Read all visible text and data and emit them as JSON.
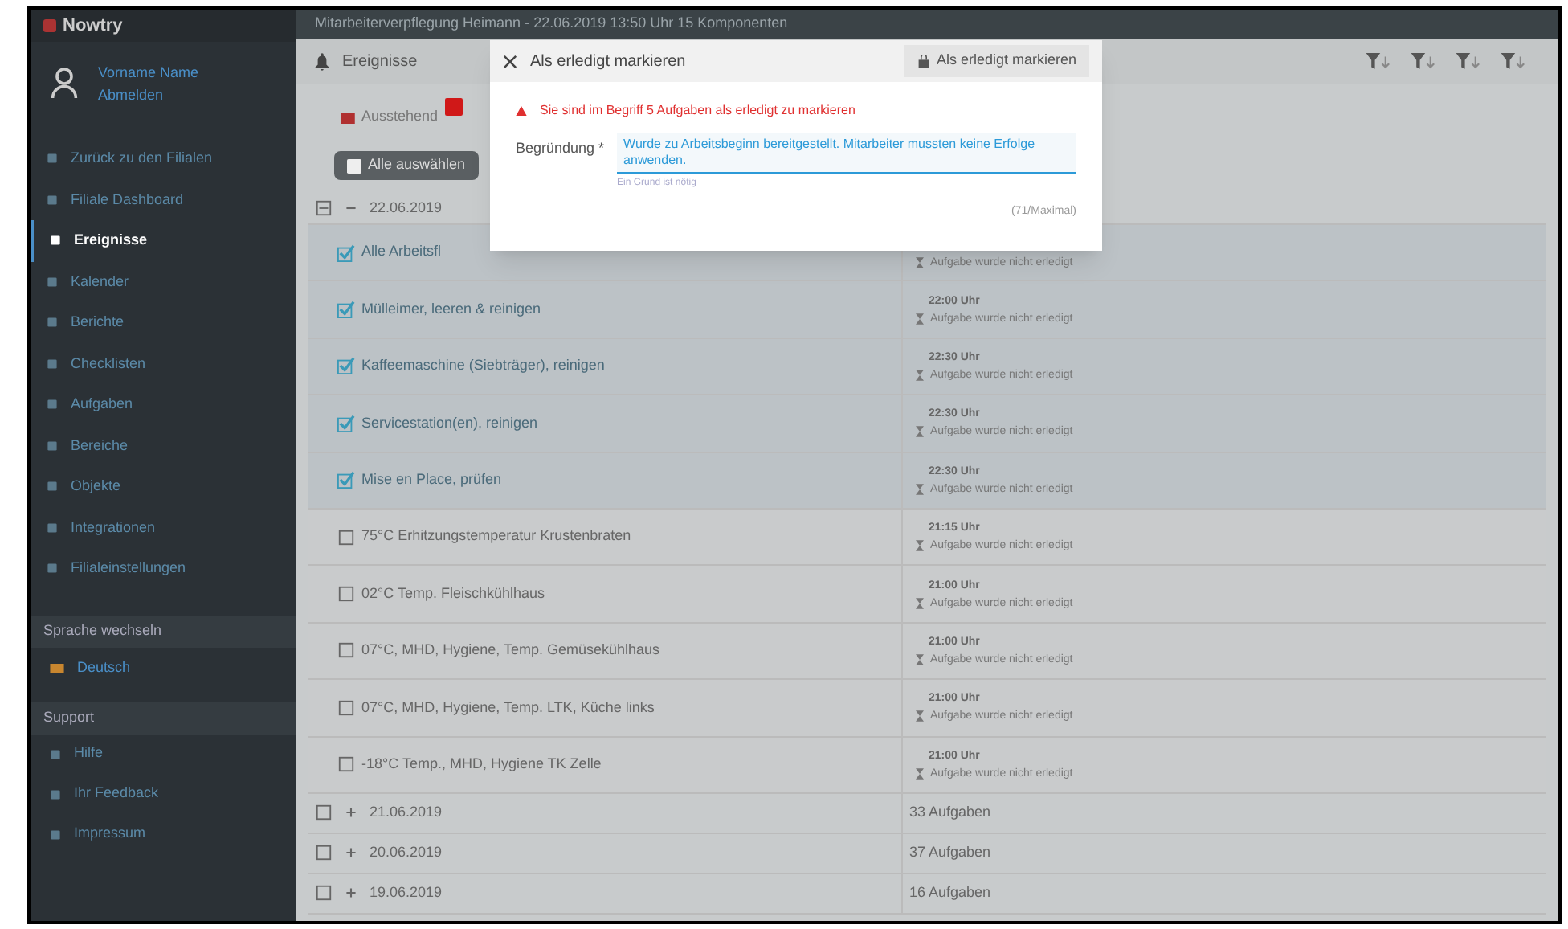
{
  "sidebar": {
    "logo": "Nowtry",
    "user": {
      "name": "Vorname Name",
      "action": "Abmelden"
    },
    "nav": [
      {
        "label": "Zurück zu den Filialen",
        "selected": false
      },
      {
        "label": "Filiale Dashboard",
        "selected": false
      },
      {
        "label": "Ereignisse",
        "selected": true
      },
      {
        "label": "Kalender",
        "selected": false
      },
      {
        "label": "Berichte",
        "selected": false
      },
      {
        "label": "Checklisten",
        "selected": false
      },
      {
        "label": "Aufgaben",
        "selected": false
      },
      {
        "label": "Bereiche",
        "selected": false
      },
      {
        "label": "Objekte",
        "selected": false
      },
      {
        "label": "Integrationen",
        "selected": false
      },
      {
        "label": "Filialeinstellungen",
        "selected": false
      }
    ],
    "language": {
      "title": "Sprache wechseln",
      "value": "Deutsch"
    },
    "support": {
      "title": "Support",
      "items": [
        "Hilfe",
        "Ihr Feedback",
        "Impressum"
      ]
    }
  },
  "topbar": {
    "title": "Mitarbeiterverpflegung Heimann - 22.06.2019 13:50 Uhr 15 Komponenten"
  },
  "header": {
    "title": "Ereignisse"
  },
  "tabs": [
    {
      "label": "Ausstehend",
      "selected": false
    }
  ],
  "select_all": "Alle auswählen",
  "groups": [
    {
      "date": "22.06.2019",
      "expanded": true,
      "checked": false,
      "tasks": [
        {
          "label": "Alle Arbeitsfl",
          "checked": true,
          "status": "Aufgabe wurde nicht erledigt"
        },
        {
          "label": "Mülleimer, leeren & reinigen",
          "checked": true,
          "time": "22:00 Uhr",
          "status": "Aufgabe wurde nicht erledigt"
        },
        {
          "label": "Kaffeemaschine (Siebträger), reinigen",
          "checked": true,
          "time": "22:30 Uhr",
          "status": "Aufgabe wurde nicht erledigt"
        },
        {
          "label": "Servicestation(en), reinigen",
          "checked": true,
          "time": "22:30 Uhr",
          "status": "Aufgabe wurde nicht erledigt"
        },
        {
          "label": "Mise en Place, prüfen",
          "checked": true,
          "time": "22:30 Uhr",
          "status": "Aufgabe wurde nicht erledigt"
        },
        {
          "label": "75°C Erhitzungstemperatur Krustenbraten",
          "checked": false,
          "time": "21:15 Uhr",
          "status": "Aufgabe wurde nicht erledigt"
        },
        {
          "label": "02°C Temp. Fleischkühlhaus",
          "checked": false,
          "time": "21:00 Uhr",
          "status": "Aufgabe wurde nicht erledigt"
        },
        {
          "label": "07°C, MHD, Hygiene, Temp. Gemüsekühlhaus",
          "checked": false,
          "time": "21:00 Uhr",
          "status": "Aufgabe wurde nicht erledigt"
        },
        {
          "label": "07°C, MHD, Hygiene, Temp. LTK, Küche links",
          "checked": false,
          "time": "21:00 Uhr",
          "status": "Aufgabe wurde nicht erledigt"
        },
        {
          "label": "-18°C Temp., MHD, Hygiene TK Zelle",
          "checked": false,
          "time": "21:00 Uhr",
          "status": "Aufgabe wurde nicht erledigt"
        }
      ]
    },
    {
      "date": "21.06.2019",
      "expanded": false,
      "checked": false,
      "summary": "33 Aufgaben"
    },
    {
      "date": "20.06.2019",
      "expanded": false,
      "checked": false,
      "summary": "37 Aufgaben"
    },
    {
      "date": "19.06.2019",
      "expanded": false,
      "checked": false,
      "summary": "16 Aufgaben"
    }
  ],
  "modal": {
    "title": "Als erledigt markieren",
    "action": "Als erledigt markieren",
    "warning": "Sie sind im Begriff 5 Aufgaben als erledigt zu markieren",
    "field": {
      "label": "Begründung *",
      "value": "Wurde zu Arbeitsbeginn bereitgestellt. Mitarbeiter mussten keine Erfolge anwenden.",
      "hint": "Ein Grund ist nötig"
    },
    "counter": "(71/Maximal)"
  }
}
